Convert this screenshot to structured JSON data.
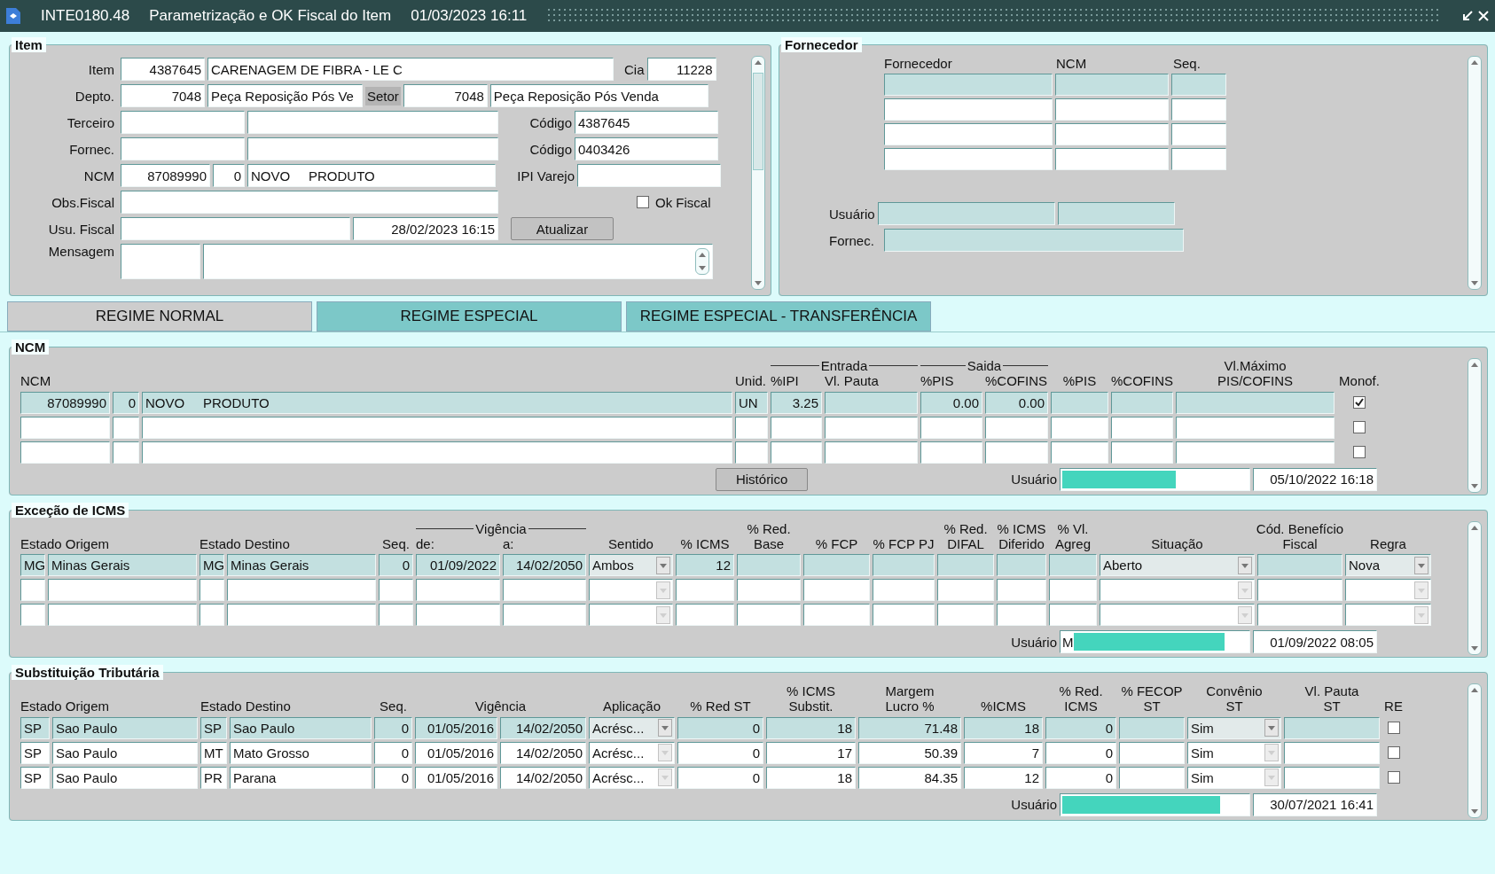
{
  "title": {
    "code": "INTE0180.48",
    "text": "Parametrização e OK Fiscal do Item",
    "datetime": "01/03/2023 16:11"
  },
  "item": {
    "title": "Item",
    "item_label": "Item",
    "item_code": "4387645",
    "item_desc": "CARENAGEM DE FIBRA - LE C",
    "cia_label": "Cia",
    "cia": "11228",
    "depto_label": "Depto.",
    "depto_code": "7048",
    "depto_desc": "Peça Reposição Pós Ve",
    "setor_label": "Setor",
    "setor_code": "7048",
    "setor_desc": "Peça Reposição Pós Venda",
    "terceiro_label": "Terceiro",
    "terceiro_codigo_label": "Código",
    "terceiro_codigo": "4387645",
    "fornec_label": "Fornec.",
    "fornec_codigo_label": "Código",
    "fornec_codigo": "0403426",
    "ncm_label": "NCM",
    "ncm": "87089990",
    "ncm_ex": "0",
    "ncm_desc": "NOVO     PRODUTO",
    "ipi_label": "IPI Varejo",
    "obs_label": "Obs.Fiscal",
    "ok_fiscal": {
      "label": "Ok Fiscal",
      "checked": false
    },
    "usu_label": "Usu. Fiscal",
    "usu_date": "28/02/2023 16:15",
    "update_button": "Atualizar",
    "mensagem_label": "Mensagem"
  },
  "fornecedor": {
    "title": "Fornecedor",
    "columns": [
      "Fornecedor",
      "NCM",
      "Seq."
    ],
    "rows": [
      {
        "selected": true
      },
      {
        "selected": false
      },
      {
        "selected": false
      },
      {
        "selected": false
      }
    ],
    "usuario_label": "Usuário",
    "fornec_label": "Fornec."
  },
  "tabs": [
    {
      "label": "REGIME NORMAL",
      "selected": true
    },
    {
      "label": "REGIME ESPECIAL",
      "selected": false
    },
    {
      "label": "REGIME ESPECIAL - TRANSFERÊNCIA",
      "selected": false
    }
  ],
  "ncm": {
    "title": "NCM",
    "columns": [
      {
        "label": "NCM",
        "kind": "number"
      },
      {
        "kind": "number"
      },
      {
        "kind": "text"
      },
      {
        "label": "Unid.",
        "kind": "text"
      },
      {
        "group": "Entrada",
        "label": "%IPI",
        "kind": "number"
      },
      {
        "label": "Vl. Pauta",
        "kind": "number"
      },
      {
        "group": "Saida",
        "label": "%PIS",
        "kind": "number"
      },
      {
        "label": "%COFINS",
        "kind": "number"
      },
      {
        "label": "%PIS",
        "kind": "number"
      },
      {
        "label": "%COFINS",
        "kind": "number"
      },
      {
        "label": "Vl.Máximo\nPIS/COFINS",
        "kind": "number"
      },
      {
        "label": "Monof.",
        "kind": "check"
      }
    ],
    "rows": [
      {
        "selected": true,
        "cells": [
          "87089990",
          "0",
          "NOVO     PRODUTO",
          "UN",
          "3.25",
          null,
          "0.00",
          "0.00",
          null,
          null,
          null,
          {
            "checked": true
          }
        ]
      },
      {
        "selected": false,
        "cells": [
          null,
          null,
          null,
          null,
          null,
          null,
          null,
          null,
          null,
          null,
          null,
          {
            "checked": false
          }
        ]
      },
      {
        "selected": false,
        "cells": [
          null,
          null,
          null,
          null,
          null,
          null,
          null,
          null,
          null,
          null,
          null,
          {
            "checked": false
          }
        ]
      }
    ],
    "history_button": "Histórico",
    "usuario_label": "Usuário",
    "usuario_date": "05/10/2022 16:18"
  },
  "excecao": {
    "title": "Exceção de ICMS",
    "columns": [
      {
        "label": "Estado Origem",
        "kind": "text"
      },
      {
        "kind": "text"
      },
      {
        "label": "Estado Destino",
        "kind": "text"
      },
      {
        "kind": "text"
      },
      {
        "label": "Seq.",
        "kind": "number"
      },
      {
        "group": "Vigência",
        "label": "de:",
        "kind": "number"
      },
      {
        "label": "a:",
        "kind": "number"
      },
      {
        "label": "Sentido",
        "kind": "select"
      },
      {
        "label": "% ICMS",
        "kind": "number"
      },
      {
        "label": "% Red.\nBase",
        "kind": "number"
      },
      {
        "label": "% FCP",
        "kind": "number"
      },
      {
        "label": "% FCP PJ",
        "kind": "number"
      },
      {
        "label": "% Red.\nDIFAL",
        "kind": "number"
      },
      {
        "label": "% ICMS\nDiferido",
        "kind": "number"
      },
      {
        "label": "% Vl.\nAgreg",
        "kind": "number"
      },
      {
        "label": "Situação",
        "kind": "select"
      },
      {
        "label": "Cód. Benefício\nFiscal",
        "kind": "number"
      },
      {
        "label": "Regra",
        "kind": "select"
      }
    ],
    "rows": [
      {
        "selected": true,
        "cells": [
          "MG",
          "Minas Gerais",
          "MG",
          "Minas Gerais",
          "0",
          "01/09/2022",
          "14/02/2050",
          "Ambos",
          "12",
          null,
          null,
          null,
          null,
          null,
          null,
          "Aberto",
          null,
          "Nova"
        ]
      },
      {
        "selected": false,
        "cells": [
          null,
          null,
          null,
          null,
          null,
          null,
          null,
          null,
          null,
          null,
          null,
          null,
          null,
          null,
          null,
          null,
          null,
          null
        ]
      },
      {
        "selected": false,
        "cells": [
          null,
          null,
          null,
          null,
          null,
          null,
          null,
          null,
          null,
          null,
          null,
          null,
          null,
          null,
          null,
          null,
          null,
          null
        ]
      }
    ],
    "usuario_label": "Usuário",
    "usuario": "M",
    "usuario_date": "01/09/2022 08:05"
  },
  "st": {
    "title": "Substituição Tributária",
    "columns": [
      {
        "label": "Estado Origem",
        "kind": "text"
      },
      {
        "kind": "text"
      },
      {
        "label": "Estado Destino",
        "kind": "text"
      },
      {
        "kind": "text"
      },
      {
        "label": "Seq.",
        "kind": "number"
      },
      {
        "label": "Vigência",
        "kind": "number"
      },
      {
        "kind": "number"
      },
      {
        "label": "Aplicação",
        "kind": "select"
      },
      {
        "label": "% Red ST",
        "kind": "number"
      },
      {
        "label": "% ICMS\nSubstit.",
        "kind": "number"
      },
      {
        "label": "Margem\nLucro %",
        "kind": "number"
      },
      {
        "label": "%ICMS",
        "kind": "number"
      },
      {
        "label": "% Red.\nICMS",
        "kind": "number"
      },
      {
        "label": "% FECOP\nST",
        "kind": "number"
      },
      {
        "label": "Convênio\nST",
        "kind": "select"
      },
      {
        "label": "Vl. Pauta\nST",
        "kind": "number"
      },
      {
        "label": "RE",
        "kind": "check"
      }
    ],
    "rows": [
      {
        "selected": true,
        "cells": [
          "SP",
          "Sao Paulo",
          "SP",
          "Sao Paulo",
          "0",
          "01/05/2016",
          "14/02/2050",
          "Acrésc...",
          "0",
          "18",
          "71.48",
          "18",
          "0",
          null,
          "Sim",
          null,
          {
            "checked": false
          }
        ]
      },
      {
        "selected": false,
        "cells": [
          "SP",
          "Sao Paulo",
          "MT",
          "Mato Grosso",
          "0",
          "01/05/2016",
          "14/02/2050",
          "Acrésc...",
          "0",
          "17",
          "50.39",
          "7",
          "0",
          null,
          "Sim",
          null,
          {
            "checked": false
          }
        ]
      },
      {
        "selected": false,
        "cells": [
          "SP",
          "Sao Paulo",
          "PR",
          "Parana",
          "0",
          "01/05/2016",
          "14/02/2050",
          "Acrésc...",
          "0",
          "18",
          "84.35",
          "12",
          "0",
          null,
          "Sim",
          null,
          {
            "checked": false
          }
        ]
      }
    ],
    "usuario_label": "Usuário",
    "usuario_date": "30/07/2021 16:41"
  }
}
